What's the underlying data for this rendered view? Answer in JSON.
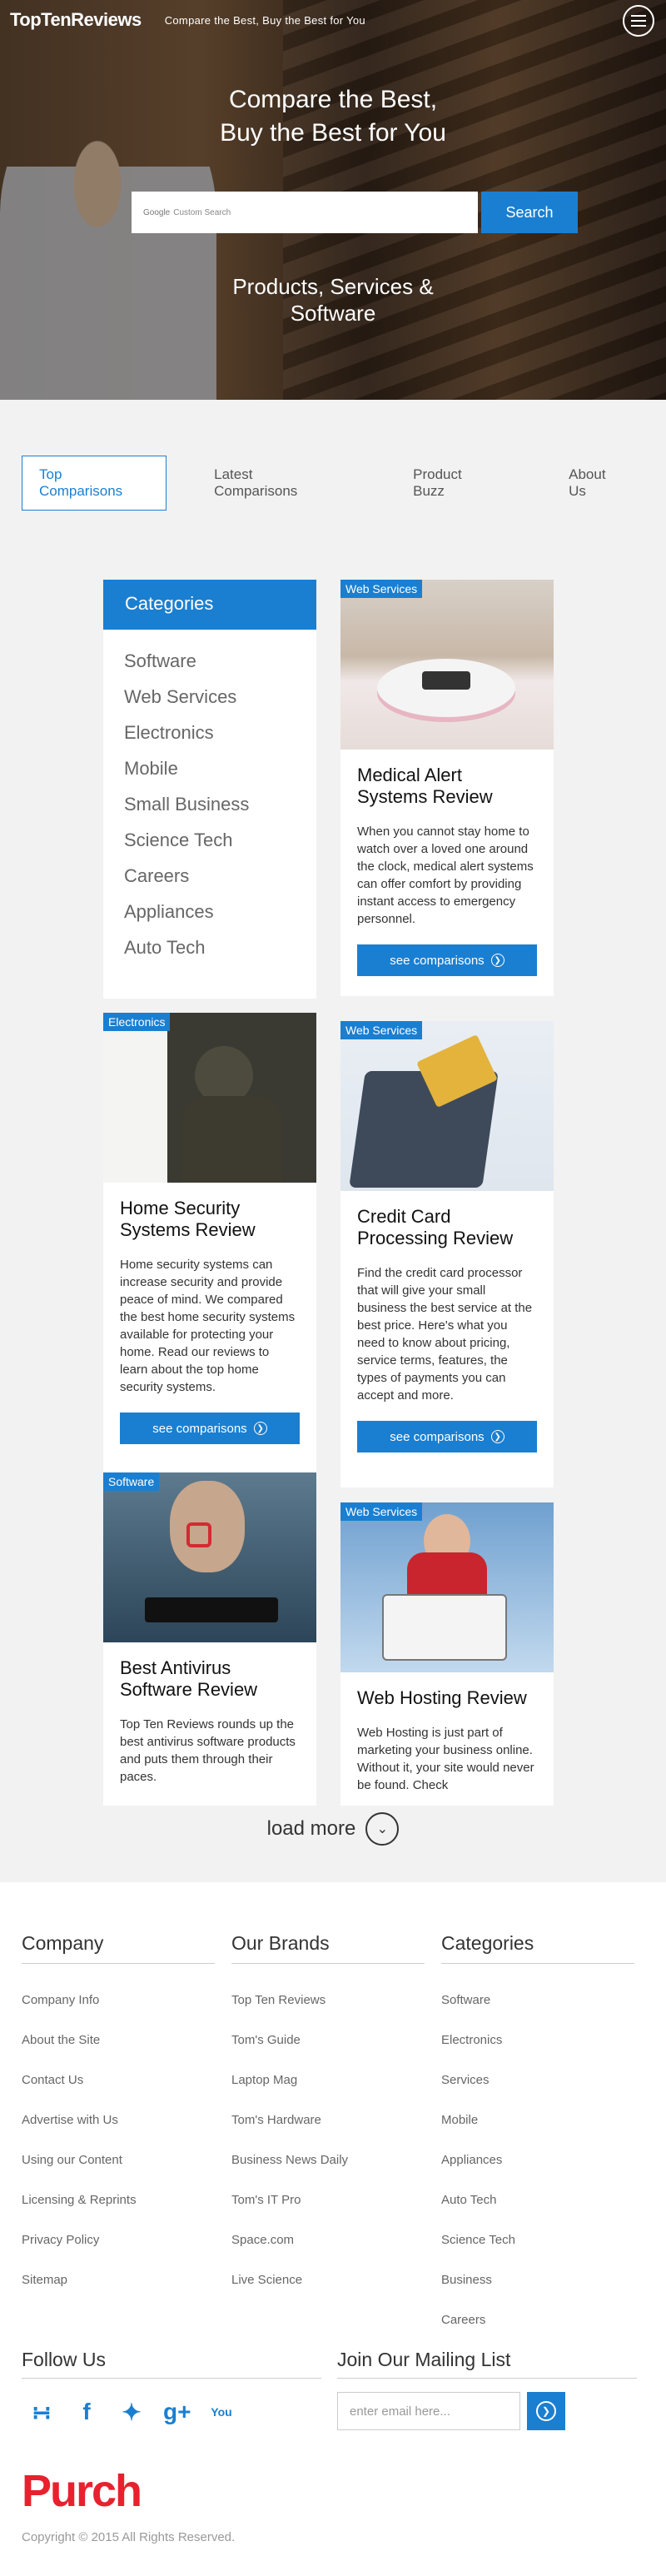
{
  "header": {
    "logo": "TopTenReviews",
    "tagline": "Compare the Best, Buy the Best for You"
  },
  "hero": {
    "title_line1": "Compare the Best,",
    "title_line2": "Buy the Best for You",
    "search_placeholder": "Custom Search",
    "search_brand": "Google",
    "search_button": "Search",
    "subtitle_line1": "Products, Services &",
    "subtitle_line2": "Software"
  },
  "tabs": [
    "Top Comparisons",
    "Latest Comparisons",
    "Product Buzz",
    "About Us"
  ],
  "categories": {
    "title": "Categories",
    "items": [
      "Software",
      "Web Services",
      "Electronics",
      "Mobile",
      "Small Business",
      "Science Tech",
      "Careers",
      "Appliances",
      "Auto Tech"
    ]
  },
  "cards": {
    "medical": {
      "badge": "Web Services",
      "title": "Medical Alert Systems Review",
      "text": "When you cannot stay home to watch over a loved one around the clock, medical alert systems can offer comfort by providing instant access to emergency personnel.",
      "button": "see comparisons"
    },
    "home": {
      "badge": "Electronics",
      "title": "Home Security Systems Review",
      "text": "Home security systems can increase security and provide peace of mind. We compared the best home security systems available for protecting your home. Read our reviews to learn about the top home security systems.",
      "button": "see comparisons"
    },
    "credit": {
      "badge": "Web Services",
      "title": "Credit Card Processing Review",
      "text": "Find the credit card processor that will give your small business the best service at the best price. Here's what you need to know about pricing, service terms, features, the types of payments you can accept and more.",
      "button": "see comparisons"
    },
    "antivirus": {
      "badge": "Software",
      "title": "Best Antivirus Software Review",
      "text": "Top Ten Reviews rounds up the best antivirus software products and puts them through their paces."
    },
    "hosting": {
      "badge": "Web Services",
      "title": "Web Hosting Review",
      "text": "Web Hosting is just part of marketing your business online. Without it, your site would never be found. Check"
    }
  },
  "load_more": "load more",
  "footer": {
    "company": {
      "title": "Company",
      "items": [
        "Company Info",
        "About the Site",
        "Contact Us",
        "Advertise with Us",
        "Using our Content",
        "Licensing & Reprints",
        "Privacy Policy",
        "Sitemap"
      ]
    },
    "brands": {
      "title": "Our Brands",
      "items": [
        "Top Ten Reviews",
        "Tom's Guide",
        "Laptop Mag",
        "Tom's Hardware",
        "Business News Daily",
        "Tom's IT Pro",
        "Space.com",
        "Live Science"
      ]
    },
    "categories": {
      "title": "Categories",
      "items": [
        "Software",
        "Electronics",
        "Services",
        "Mobile",
        "Appliances",
        "Auto Tech",
        "Science Tech",
        "Business",
        "Careers"
      ]
    },
    "follow_title": "Follow Us",
    "mailing_title": "Join Our Mailing List",
    "email_placeholder": "enter email here...",
    "purch": "Purch",
    "copyright": "Copyright © 2015 All Rights Reserved."
  },
  "colors": {
    "accent": "#1a7fd1",
    "purch": "#e8212e",
    "panel": "#f2f2f2"
  }
}
